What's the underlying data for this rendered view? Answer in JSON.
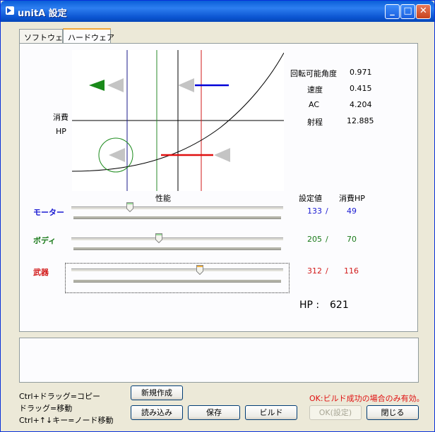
{
  "window": {
    "title": "unitA 設定"
  },
  "tabs": [
    {
      "label": "ソフトウェア"
    },
    {
      "label": "ハードウェア"
    }
  ],
  "chart_data": {
    "type": "diagram",
    "ylabel_line1": "消費",
    "ylabel_line2": "HP",
    "xlabel": "性能"
  },
  "stats": {
    "rotation_label": "回転可能角度",
    "rotation_value": "0.971",
    "speed_label": "速度",
    "speed_value": "0.415",
    "ac_label": "AC",
    "ac_value": "4.204",
    "range_label": "射程",
    "range_value": "12.885"
  },
  "columns": {
    "setting": "設定値",
    "hp": "消費HP"
  },
  "sliders": [
    {
      "label": "モーター",
      "setting": "133",
      "slash": "/",
      "hp": "49",
      "color": "#1a1ad2",
      "level": 0.27
    },
    {
      "label": "ボディ",
      "setting": "205",
      "slash": "/",
      "hp": "70",
      "color": "#1a7a1a",
      "level": 0.41
    },
    {
      "label": "武器",
      "setting": "312",
      "slash": "/",
      "hp": "116",
      "color": "#d21a1a",
      "level": 0.61
    }
  ],
  "total_hp": {
    "label": "HP :",
    "value": "621"
  },
  "help": {
    "line1": "Ctrl+ドラッグ=コピー",
    "line2": "ドラッグ=移動",
    "line3": "Ctrl+↑↓キー=ノード移動"
  },
  "buttons": {
    "new": "新規作成",
    "load": "読み込み",
    "save": "保存",
    "build": "ビルド",
    "ok": "OK(設定)",
    "close": "閉じる"
  },
  "notice": "OK:ビルド成功の場合のみ有効。"
}
